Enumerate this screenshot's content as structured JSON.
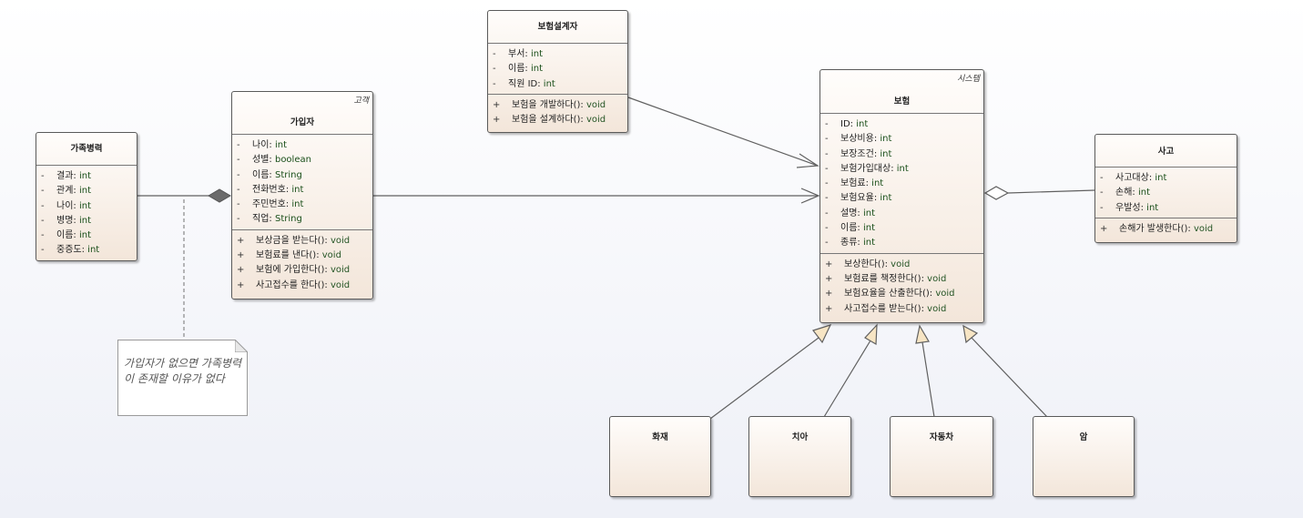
{
  "classes": {
    "family_history": {
      "name": "가족병력",
      "attributes": [
        {
          "vis": "-",
          "name": "결과",
          "type": "int"
        },
        {
          "vis": "-",
          "name": "관계",
          "type": "int"
        },
        {
          "vis": "-",
          "name": "나이",
          "type": "int"
        },
        {
          "vis": "-",
          "name": "병명",
          "type": "int"
        },
        {
          "vis": "-",
          "name": "이름",
          "type": "int"
        },
        {
          "vis": "-",
          "name": "중증도",
          "type": "int"
        }
      ]
    },
    "subscriber": {
      "name": "가입자",
      "stereotype": "고객",
      "attributes": [
        {
          "vis": "-",
          "name": "나이",
          "type": "int"
        },
        {
          "vis": "-",
          "name": "성별",
          "type": "boolean"
        },
        {
          "vis": "-",
          "name": "이름",
          "type": "String"
        },
        {
          "vis": "-",
          "name": "전화번호",
          "type": "int"
        },
        {
          "vis": "-",
          "name": "주민번호",
          "type": "int"
        },
        {
          "vis": "-",
          "name": "직업",
          "type": "String"
        }
      ],
      "operations": [
        {
          "vis": "+",
          "name": "보상금을 받는다()",
          "type": "void"
        },
        {
          "vis": "+",
          "name": "보험료를 낸다()",
          "type": "void"
        },
        {
          "vis": "+",
          "name": "보험에 가입한다()",
          "type": "void"
        },
        {
          "vis": "+",
          "name": "사고접수를 한다()",
          "type": "void"
        }
      ]
    },
    "designer": {
      "name": "보험설계자",
      "attributes": [
        {
          "vis": "-",
          "name": "부서",
          "type": "int"
        },
        {
          "vis": "-",
          "name": "이름",
          "type": "int"
        },
        {
          "vis": "-",
          "name": "직원 ID",
          "type": "int"
        }
      ],
      "operations": [
        {
          "vis": "+",
          "name": "보험을 개발하다()",
          "type": "void"
        },
        {
          "vis": "+",
          "name": "보험을 설계하다()",
          "type": "void"
        }
      ]
    },
    "insurance": {
      "name": "보험",
      "stereotype": "시스템",
      "attributes": [
        {
          "vis": "-",
          "name": "ID",
          "type": "int"
        },
        {
          "vis": "-",
          "name": "보상비용",
          "type": "int"
        },
        {
          "vis": "-",
          "name": "보장조건",
          "type": "int"
        },
        {
          "vis": "-",
          "name": "보험가입대상",
          "type": "int"
        },
        {
          "vis": "-",
          "name": "보험료",
          "type": "int"
        },
        {
          "vis": "-",
          "name": "보험요율",
          "type": "int"
        },
        {
          "vis": "-",
          "name": "설명",
          "type": "int"
        },
        {
          "vis": "-",
          "name": "이름",
          "type": "int"
        },
        {
          "vis": "-",
          "name": "종류",
          "type": "int"
        }
      ],
      "operations": [
        {
          "vis": "+",
          "name": "보상한다()",
          "type": "void"
        },
        {
          "vis": "+",
          "name": "보험료를 책정한다()",
          "type": "void"
        },
        {
          "vis": "+",
          "name": "보험요율을 산출한다()",
          "type": "void"
        },
        {
          "vis": "+",
          "name": "사고접수를 받는다()",
          "type": "void"
        }
      ]
    },
    "accident": {
      "name": "사고",
      "attributes": [
        {
          "vis": "-",
          "name": "사고대상",
          "type": "int"
        },
        {
          "vis": "-",
          "name": "손해",
          "type": "int"
        },
        {
          "vis": "-",
          "name": "우발성",
          "type": "int"
        }
      ],
      "operations": [
        {
          "vis": "+",
          "name": "손해가 발생한다()",
          "type": "void"
        }
      ]
    },
    "fire": {
      "name": "화재"
    },
    "dental": {
      "name": "치아"
    },
    "car": {
      "name": "자동차"
    },
    "cancer": {
      "name": "암"
    }
  },
  "note": {
    "text": "가입자가 없으면 가족병력이 존재할 이유가 없다"
  },
  "colors": {
    "line": "#606060",
    "generalization_fill": "#f7e5c4",
    "composition_fill": "#6b6b6b"
  }
}
